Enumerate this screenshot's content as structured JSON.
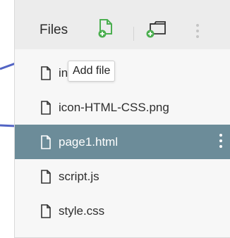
{
  "panel": {
    "title": "Files",
    "add_file_tooltip": "Add file"
  },
  "icons": {
    "add_file": "file-plus-icon",
    "add_folder": "folder-plus-icon",
    "more": "kebab-menu-icon",
    "file": "file-icon"
  },
  "files": [
    {
      "name": "ind",
      "selected": false
    },
    {
      "name": "icon-HTML-CSS.png",
      "selected": false
    },
    {
      "name": "page1.html",
      "selected": true
    },
    {
      "name": "script.js",
      "selected": false
    },
    {
      "name": "style.css",
      "selected": false
    }
  ],
  "colors": {
    "accent_green": "#4caf50",
    "selection": "#6c8c99",
    "arrow": "#5264c4",
    "header_bg": "#ececec",
    "panel_bg": "#f7f7f7"
  }
}
